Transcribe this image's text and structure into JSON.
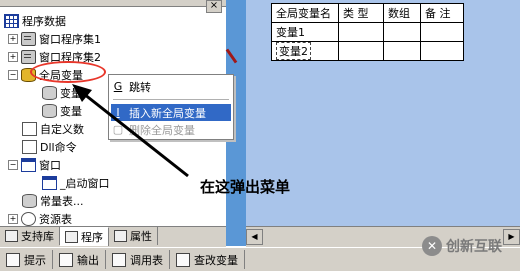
{
  "tree": {
    "root": "程序数据",
    "items": [
      {
        "label": "窗口程序集1",
        "icon": "book-icon"
      },
      {
        "label": "窗口程序集2",
        "icon": "book-icon"
      },
      {
        "label": "全局变量",
        "icon": "db-icon"
      },
      {
        "label": "变量1",
        "icon": "db-icon"
      },
      {
        "label": "变量",
        "icon": "db-icon"
      },
      {
        "label": "自定义数",
        "icon": "type-icon"
      },
      {
        "label": "Dll命令",
        "icon": "dll-icon"
      },
      {
        "label": "窗口",
        "icon": "window-icon"
      },
      {
        "label": "_启动窗口",
        "icon": "window-icon"
      },
      {
        "label": "常量表...",
        "icon": "db-icon"
      },
      {
        "label": "资源表",
        "icon": "resource-icon"
      }
    ]
  },
  "context_menu": {
    "items": [
      {
        "shortcut": "G",
        "label": "跳转",
        "state": "normal"
      },
      {
        "shortcut": "I",
        "label": "插入新全局变量",
        "state": "selected"
      },
      {
        "shortcut": "",
        "label": "删除全局变量",
        "state": "disabled"
      }
    ]
  },
  "left_tabs": [
    "支持库",
    "程序",
    "属性"
  ],
  "var_table": {
    "headers": [
      "全局变量名",
      "类 型",
      "数组",
      "备 注"
    ],
    "rows": [
      [
        "变量1",
        "",
        "",
        ""
      ],
      [
        "变量2",
        "",
        "",
        ""
      ]
    ]
  },
  "annotation": "在这弹出菜单",
  "bottom_bar": [
    "提示",
    "输出",
    "调用表",
    "查改变量"
  ],
  "watermark": "创新互联",
  "colors": {
    "highlight": "#e8362a",
    "menu_selected": "#3169c6",
    "editor_bg": "#a9c4ea",
    "strip": "#5a97d6"
  }
}
